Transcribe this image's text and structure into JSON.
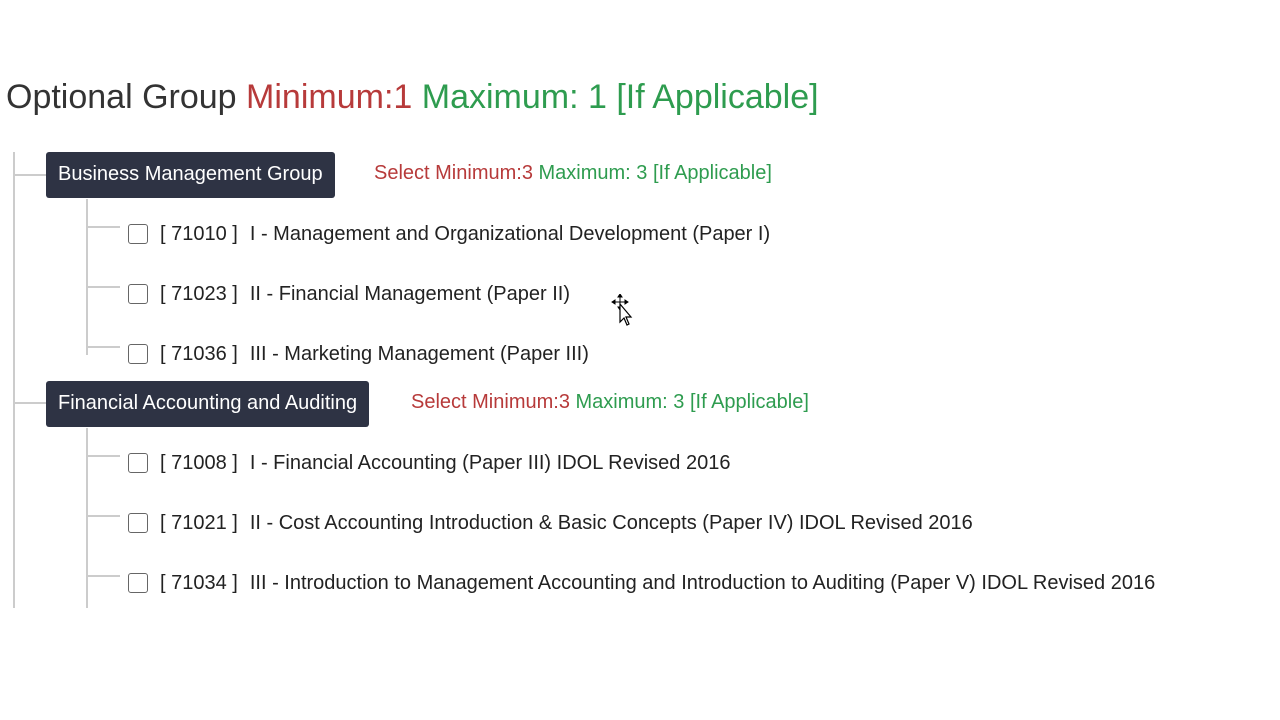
{
  "heading": {
    "label": "Optional Group",
    "min_text": "Minimum:1",
    "max_text": "Maximum: 1 [If Applicable]"
  },
  "groups": [
    {
      "name": "Business Management Group",
      "rule_min": "Select Minimum:3",
      "rule_max": "Maximum: 3 [If Applicable]",
      "courses": [
        {
          "code": "[ 71010 ]",
          "title": "I - Management and Organizational Development (Paper I)",
          "checked": false
        },
        {
          "code": "[ 71023 ]",
          "title": "II - Financial Management (Paper II)",
          "checked": false
        },
        {
          "code": "[ 71036 ]",
          "title": "III - Marketing Management (Paper III)",
          "checked": false
        }
      ]
    },
    {
      "name": "Financial Accounting and Auditing",
      "rule_min": "Select Minimum:3",
      "rule_max": "Maximum: 3 [If Applicable]",
      "courses": [
        {
          "code": "[ 71008 ]",
          "title": "I - Financial Accounting (Paper III) IDOL Revised 2016",
          "checked": false
        },
        {
          "code": "[ 71021 ]",
          "title": "II - Cost Accounting Introduction & Basic Concepts (Paper IV) IDOL Revised 2016",
          "checked": false
        },
        {
          "code": "[ 71034 ]",
          "title": "III - Introduction to Management Accounting and Introduction to Auditing (Paper V) IDOL Revised 2016",
          "checked": false
        }
      ]
    }
  ],
  "colors": {
    "min": "#b73a3a",
    "max": "#2e9c4f",
    "group_bg": "#2e3344",
    "tree_line": "#cccccc"
  }
}
